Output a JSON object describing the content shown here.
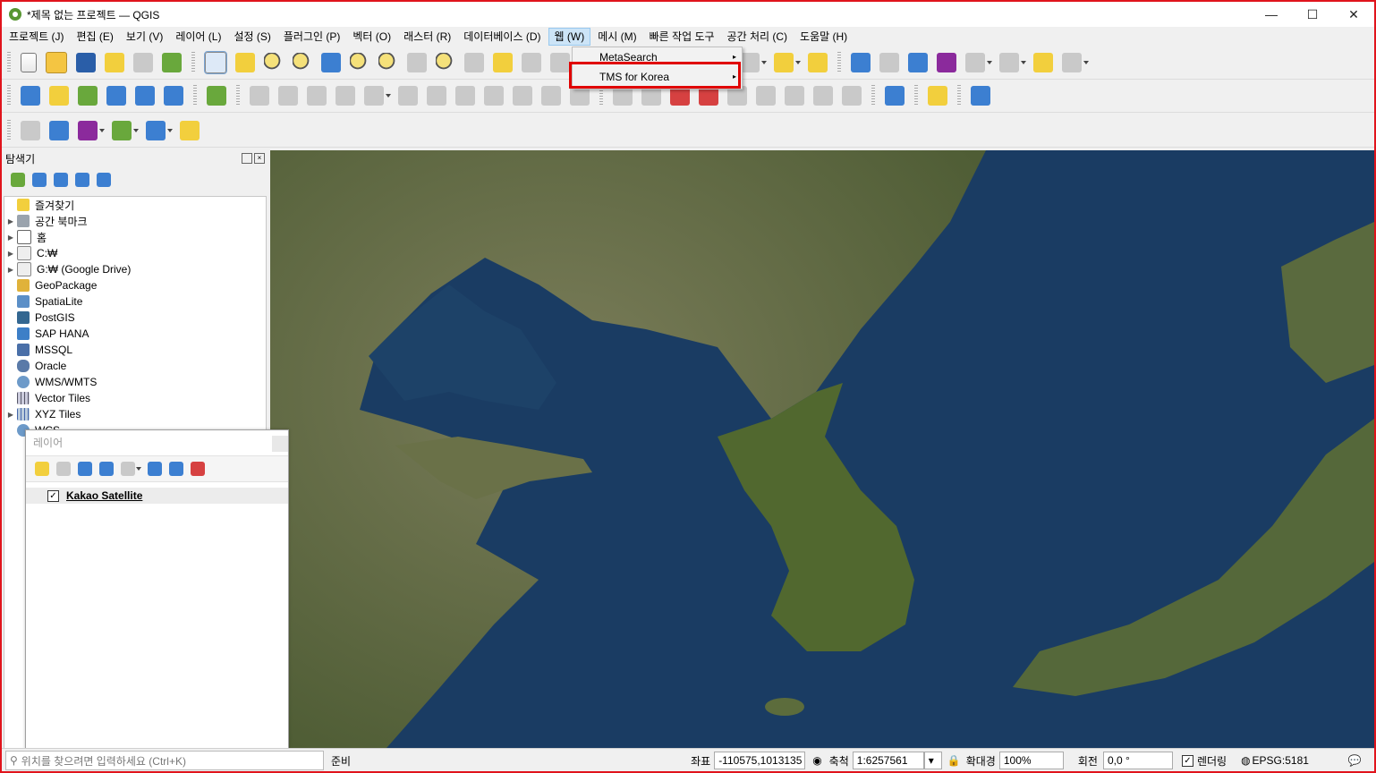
{
  "window": {
    "title": "*제목 없는 프로젝트 — QGIS",
    "min": "—",
    "max": "☐",
    "close": "✕"
  },
  "menubar": [
    "프로젝트 (J)",
    "편집 (E)",
    "보기 (V)",
    "레이어 (L)",
    "설정 (S)",
    "플러그인 (P)",
    "벡터 (O)",
    "래스터 (R)",
    "데이터베이스 (D)",
    "웹 (W)",
    "메시 (M)",
    "빠른 작업 도구",
    "공간 처리 (C)",
    "도움말 (H)"
  ],
  "web_menu": {
    "items": [
      {
        "label": "MetaSearch",
        "submenu": "▸"
      },
      {
        "label": "TMS for Korea",
        "submenu": "▸"
      }
    ]
  },
  "browser": {
    "title": "탐색기",
    "items": [
      {
        "label": "즐겨찾기",
        "icon": "star-icon"
      },
      {
        "label": "공간 북마크",
        "icon": "bookmark-icon"
      },
      {
        "label": "홈",
        "icon": "home-icon"
      },
      {
        "label": "C:₩",
        "icon": "drive-icon"
      },
      {
        "label": "G:₩ (Google Drive)",
        "icon": "drive-icon"
      },
      {
        "label": "GeoPackage",
        "icon": "geopackage-icon"
      },
      {
        "label": "SpatiaLite",
        "icon": "spatialite-icon"
      },
      {
        "label": "PostGIS",
        "icon": "postgis-icon"
      },
      {
        "label": "SAP HANA",
        "icon": "hana-icon"
      },
      {
        "label": "MSSQL",
        "icon": "mssql-icon"
      },
      {
        "label": "Oracle",
        "icon": "oracle-icon"
      },
      {
        "label": "WMS/WMTS",
        "icon": "wms-icon"
      },
      {
        "label": "Vector Tiles",
        "icon": "vector-tiles-icon"
      },
      {
        "label": "XYZ Tiles",
        "icon": "xyz-icon"
      },
      {
        "label": "WCS",
        "icon": "wcs-icon"
      }
    ]
  },
  "layers": {
    "title": "레이어",
    "items": [
      {
        "label": "Kakao Satellite",
        "checked": "✓"
      }
    ]
  },
  "status": {
    "search_placeholder": "위치를 찾으려면 입력하세요 (Ctrl+K)",
    "ready": "준비",
    "coord_label": "좌표",
    "coord_value": "-110575,1013135",
    "scale_label": "축척",
    "scale_value": "1:6257561",
    "magnifier_label": "확대경",
    "magnifier_value": "100%",
    "rotation_label": "회전",
    "rotation_value": "0,0 °",
    "render_label": "렌더링",
    "render_checked": "✓",
    "crs": "EPSG:5181"
  },
  "colors": {
    "highlight": "#e00000",
    "sea": "#183a5e",
    "land": "#5e6a3c"
  }
}
